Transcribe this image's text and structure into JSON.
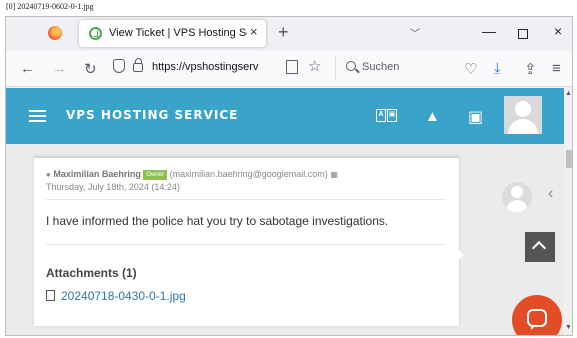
{
  "image_filename": "[0] 20240719-0602-0-1.jpg",
  "browser": {
    "tab": {
      "title": "View Ticket | VPS Hosting Servic",
      "close": "×"
    },
    "new_tab": "+",
    "tab_list": "﹀",
    "window": {
      "minimize": "—",
      "maximize": "",
      "close": "×"
    },
    "nav": {
      "back": "←",
      "forward": "→",
      "reload": "↻"
    },
    "url": "https://vpshostingserv",
    "search_placeholder": "Suchen",
    "toolbar": {
      "pocket": "♡",
      "downloads": "⤓",
      "extensions": "⇪",
      "menu": "≡"
    }
  },
  "site": {
    "brand": "VPS HOSTING SERVICE",
    "lang_icon": [
      "A",
      "▣"
    ],
    "bell_icon": "🔔",
    "cart_icon": "🛒"
  },
  "ticket_reply": {
    "user_icon": "👤",
    "author": "Maximilian Baehring",
    "badge": "Owner",
    "email": "(maximilian.baehring@googlemail.com)",
    "calendar_icon": "📅",
    "date": "Thursday, July 18th, 2024 (14:24)",
    "message": "I have informed the police hat you try to sabotage investigations.",
    "attachments_title": "Attachments (1)",
    "attachment_file": "20240718-0430-0-1.jpg"
  },
  "side": {
    "chevron": "‹"
  },
  "scrollbar": {
    "up": "▲",
    "down": "▼"
  },
  "colors": {
    "header": "#3aa3c9",
    "badge": "#8cc152",
    "chat": "#e34c26",
    "link": "#2f76b3"
  }
}
